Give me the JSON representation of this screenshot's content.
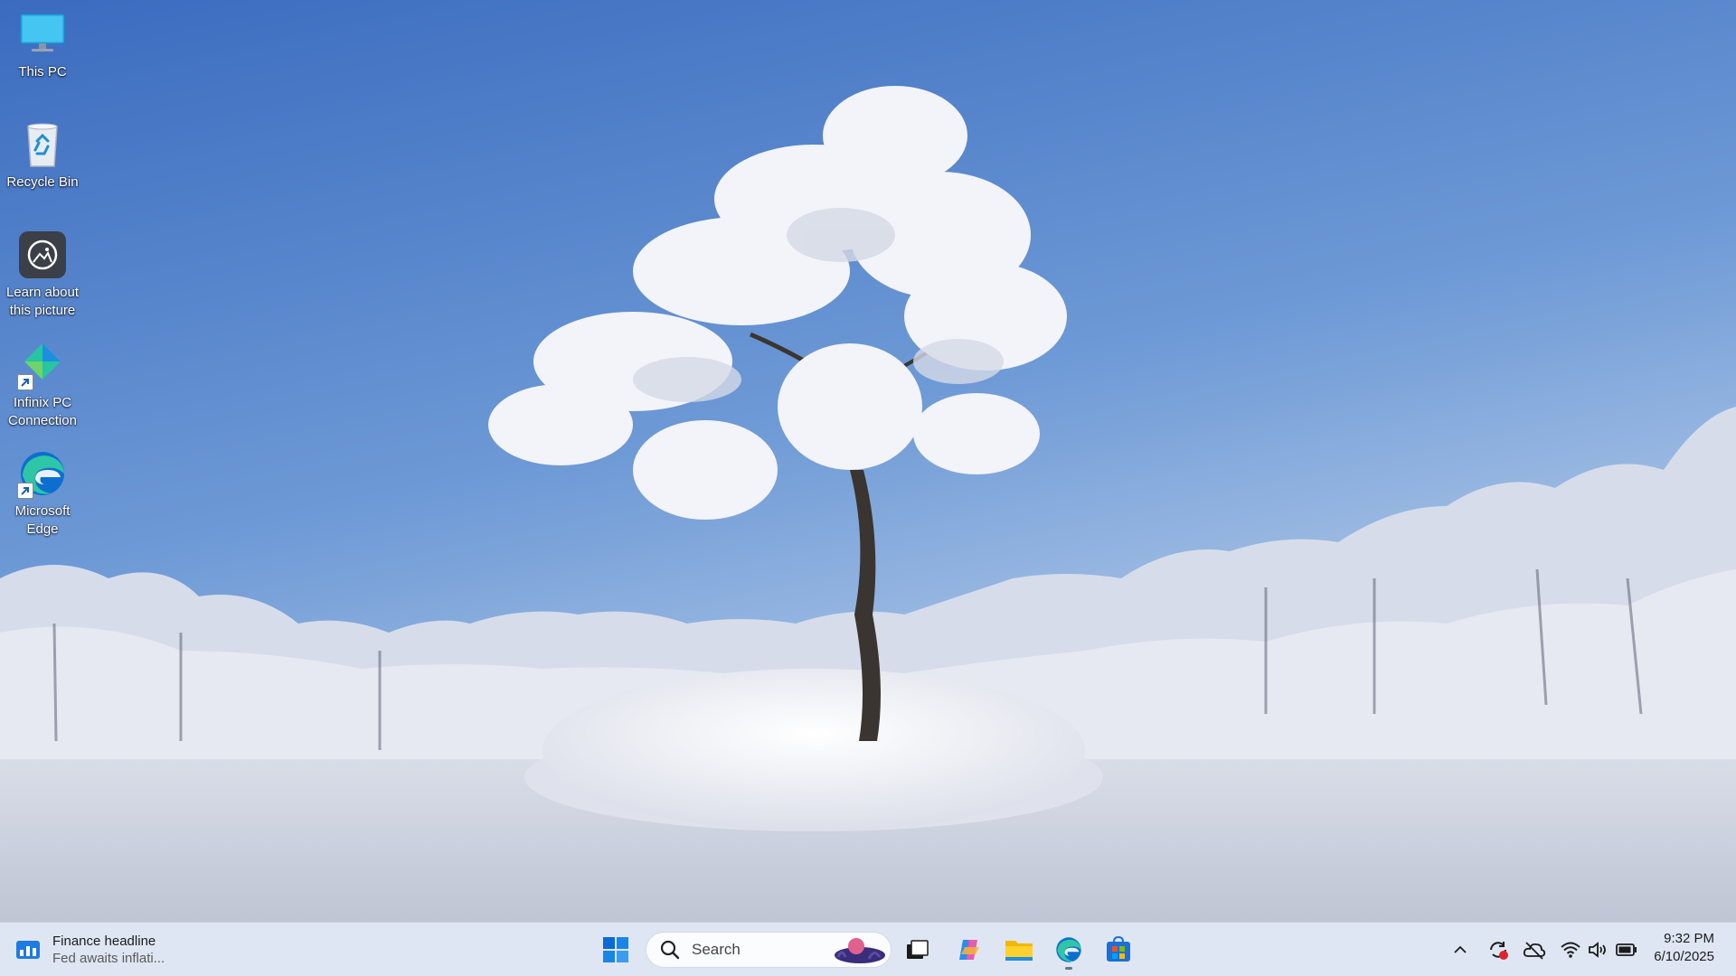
{
  "desktop": {
    "icons": [
      {
        "label": "This PC",
        "icon": "this-pc-icon"
      },
      {
        "label": "Recycle Bin",
        "icon": "recycle-bin-icon"
      },
      {
        "label": "Learn about this picture",
        "icon": "learn-picture-icon"
      },
      {
        "label": "Infinix PC Connection",
        "icon": "infinix-pc-connection-icon"
      },
      {
        "label": "Microsoft Edge",
        "icon": "edge-icon"
      }
    ]
  },
  "taskbar": {
    "widget": {
      "title": "Finance headline",
      "subtitle": "Fed awaits inflati..."
    },
    "search": {
      "placeholder": "Search"
    },
    "pinned": [
      "start-button",
      "task-view",
      "copilot",
      "file-explorer",
      "edge",
      "microsoft-store"
    ],
    "tray": [
      "show-hidden-icons",
      "sync-status",
      "onedrive-offline",
      "wifi",
      "volume",
      "battery"
    ],
    "clock": {
      "time": "9:32 PM",
      "date": "6/10/2025"
    }
  },
  "colors": {
    "taskbar_bg": "#dfe6f3",
    "sky_top": "#3a6cc0",
    "accent_blue": "#0a6ad6"
  }
}
